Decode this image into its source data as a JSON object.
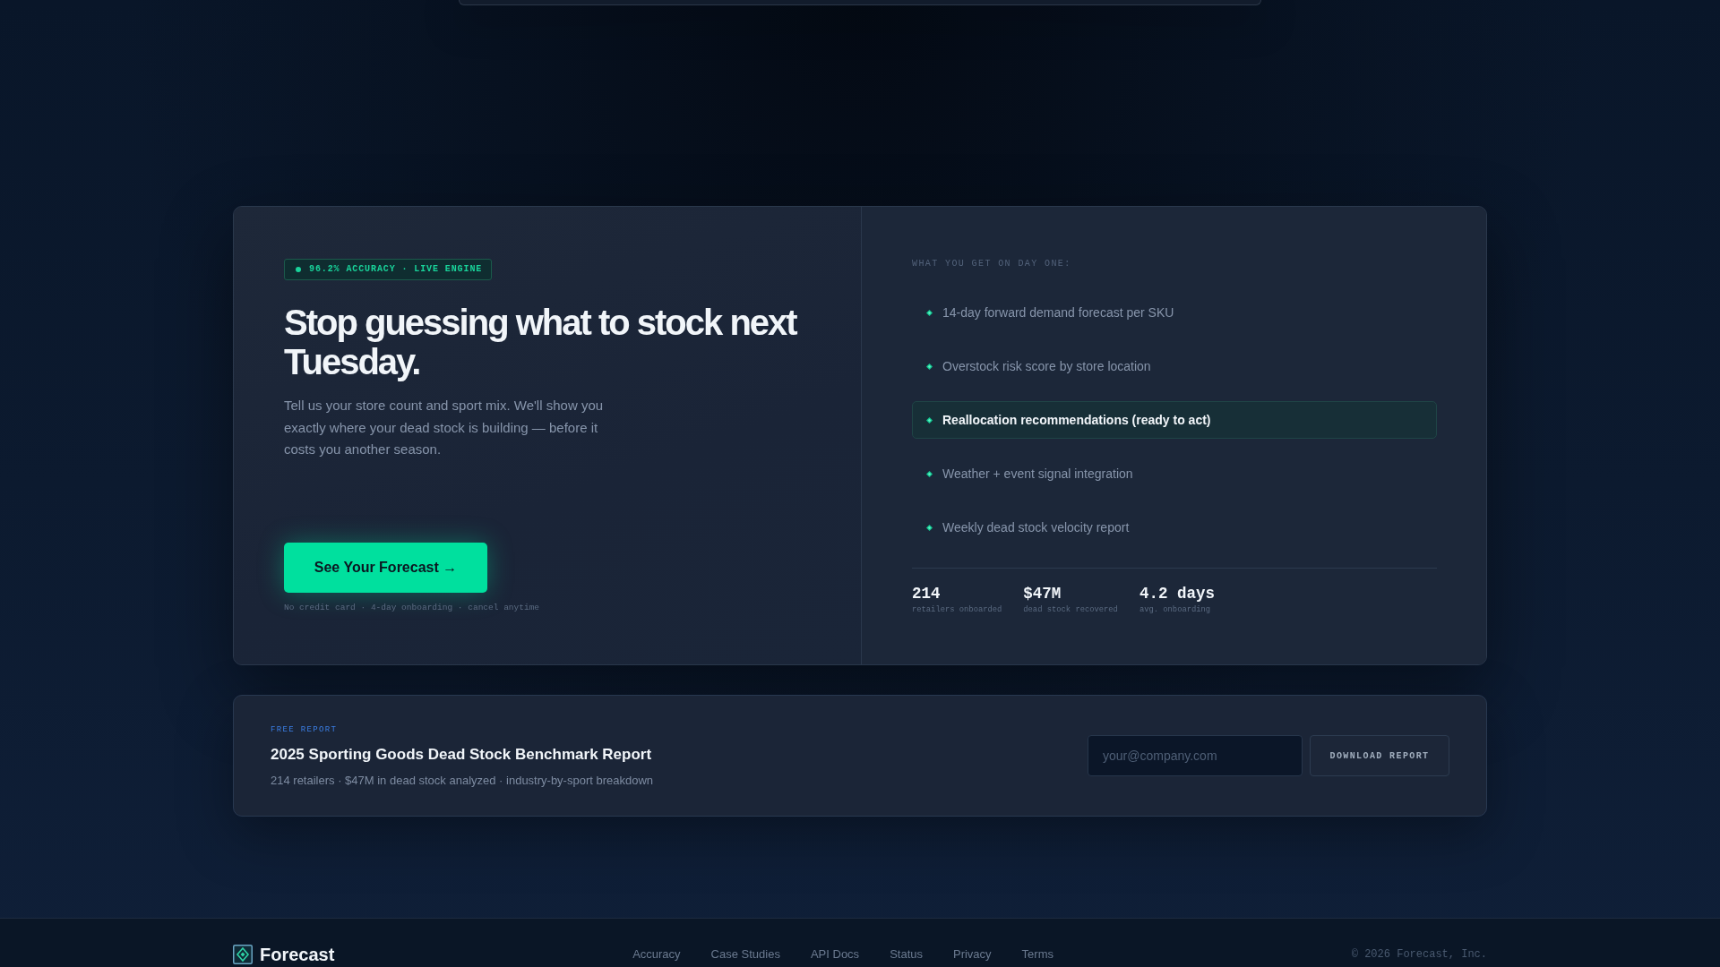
{
  "hero": {
    "badge": {
      "text": "96.2% ACCURACY · LIVE ENGINE"
    },
    "headline": "Stop guessing what to stock next Tuesday.",
    "description": "Tell us your store count and sport mix. We'll show you exactly where your dead stock is building — before it costs you another season.",
    "cta": "See Your Forecast →",
    "fine_print": "No credit card · 4-day onboarding · cancel anytime"
  },
  "features": {
    "label": "WHAT YOU GET ON DAY ONE:",
    "items": [
      {
        "text": "14-day forward demand forecast per SKU",
        "selected": false
      },
      {
        "text": "Overstock risk score by store location",
        "selected": false
      },
      {
        "text": "Reallocation recommendations (ready to act)",
        "selected": true
      },
      {
        "text": "Weather + event signal integration",
        "selected": false
      },
      {
        "text": "Weekly dead stock velocity report",
        "selected": false
      }
    ],
    "stats": [
      {
        "value": "214",
        "label": "retailers onboarded"
      },
      {
        "value": "$47M",
        "label": "dead stock recovered"
      },
      {
        "value": "4.2 days",
        "label": "avg. onboarding"
      }
    ]
  },
  "report": {
    "eyebrow": "FREE REPORT",
    "title": "2025 Sporting Goods Dead Stock Benchmark Report",
    "subtitle": "214 retailers · $47M in dead stock analyzed · industry-by-sport breakdown",
    "email": {
      "placeholder": "your@company.com"
    },
    "button": "DOWNLOAD REPORT"
  },
  "footer": {
    "brand": "Forecast",
    "links": [
      "Accuracy",
      "Case Studies",
      "API Docs",
      "Status",
      "Privacy",
      "Terms"
    ],
    "copyright": "© 2026 Forecast, Inc."
  }
}
